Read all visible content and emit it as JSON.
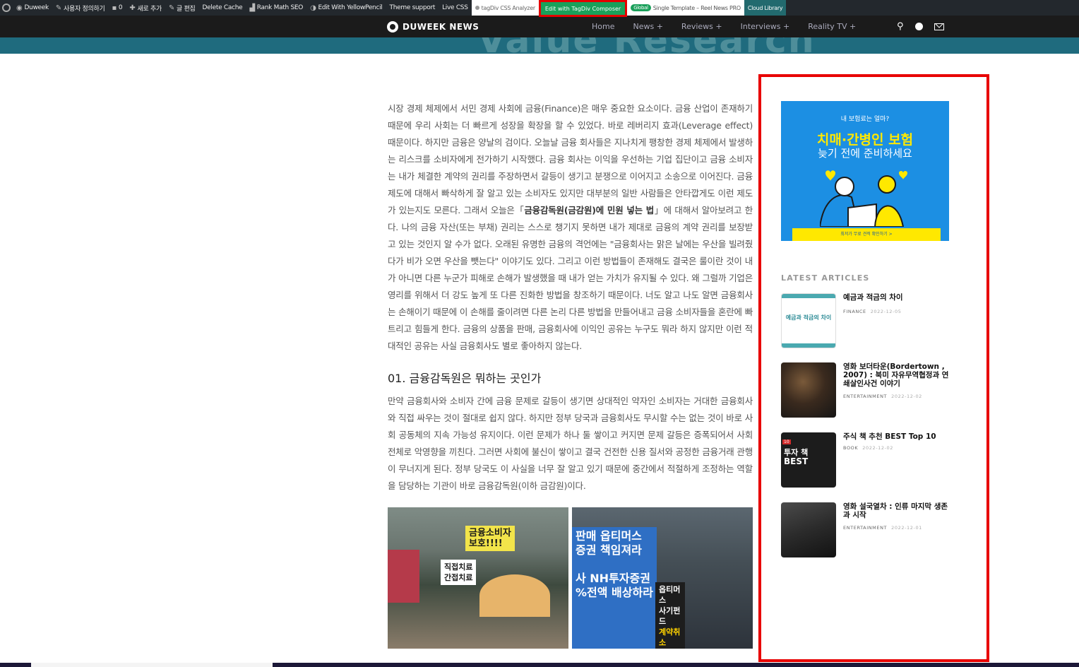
{
  "admin_bar": {
    "site_name": "Duweek",
    "customize": "사용자 정의하기",
    "comments": "0",
    "new": "새로 추가",
    "edit_post": "글 편집",
    "delete_cache": "Delete Cache",
    "rank_math": "Rank Math SEO",
    "yellowpencil": "Edit With YellowPencil",
    "theme_support": "Theme support",
    "live_css": "Live CSS",
    "css_analyzer": "tagDiv CSS Analyzer",
    "edit_composer": "Edit with TagDiv Composer",
    "global_badge": "Global",
    "single_template": "Single Template – Reel News PRO",
    "cloud_library": "Cloud Library"
  },
  "header": {
    "logo": "DUWEEK NEWS",
    "nav": [
      "Home",
      "News +",
      "Reviews +",
      "Interviews +",
      "Reality TV +"
    ]
  },
  "banner": {
    "text": "Value Research"
  },
  "article": {
    "intro_part1": "시장 경제 체제에서 서민 경제 사회에 금융(Finance)은 매우 중요한 요소이다. 금융 산업이 존재하기 때문에 우리 사회는 더 빠르게 성장을 확장을 할 수 있었다. 바로 레버리지 효과(Leverage effect) 때문이다. 하지만 금융은 양날의 검이다. 오늘날 금융 회사들은 지나치게 팽창한 경제 체제에서 발생하는 리스크를 소비자에게 전가하기 시작했다. 금융 회사는 이익을 우선하는 기업 집단이고 금융 소비자는 내가 체결한 계약의 권리를 주장하면서 갈등이 생기고 분쟁으로 이어지고 소송으로 이어진다. 금융 제도에 대해서 빠삭하게 잘 알고 있는 소비자도 있지만 대부분의 일반 사람들은 안타깝게도 이런 제도가 있는지도 모른다. 그래서 오늘은「",
    "intro_bold": "금융감독원(금감원)에 민원 넣는 법",
    "intro_part2": "」에 대해서 알아보려고 한다. 나의 금융 자산(또는 부채) 권리는 스스로 챙기지 못하면 내가 제대로 금융의 계약 권리를 보장받고 있는 것인지 알 수가 없다. 오래된 유명한 금융의 격언에는 \"금융회사는 맑은 날에는 우산을 빌려줬다가 비가 오면 우산을 뺏는다\" 이야기도 있다. 그리고 이런 방법들이 존재해도 결국은 룰이란 것이 내가 아니면 다른 누군가 피해로 손해가 발생했을 때 내가 얻는 가치가 유지될 수 있다. 왜 그럴까 기업은 영리를 위해서 더 강도 높게 또 다른 진화한 방법을 창조하기 때문이다. 너도 알고 나도 알면 금융회사는 손해이기 때문에 이 손해를 줄이려면 다른 논리 다른 방법을 만들어내고 금융 소비자들을 혼란에 빠트리고 힘들게 한다. 금융의 상품을 판매, 금융회사에 이익인 공유는 누구도 뭐라 하지 않지만 이런 적대적인 공유는 사실 금융회사도 별로 좋아하지 않는다.",
    "heading": "01. 금융감독원은 뭐하는 곳인가",
    "section_para": "만약 금융회사와 소비자 간에 금융 문제로 갈등이 생기면 상대적인 약자인 소비자는 거대한 금융회사와 직접 싸우는 것이 절대로 쉽지 않다. 하지만 정부 당국과 금융회사도 무시할 수는 없는 것이 바로 사회 공동체의 지속 가능성 유지이다. 이런 문제가 하나 둘 쌓이고 커지면 문제 갈등은 증폭되어서 사회 전체로 악영향을 끼친다. 그러면 사회에 불신이 쌓이고 결국 건전한 신용 질서와 공정한 금융거래 관행이 무너지게 된다. 정부 당국도 이 사실을 너무 잘 알고 있기 때문에 중간에서 적절하게 조정하는 역할을 담당하는 기관이 바로 금융감독원(이하 금감원)이다.",
    "photo1_signs": [
      "금융소비자",
      "보호!!!!",
      "직접치료",
      "간접치료"
    ],
    "photo2_signs": [
      "판매 옵티머스",
      "증권 책임져라",
      "사 NH투자증권",
      "%전액 배상하라",
      "옵티머스",
      "사기펀드",
      "계약취소"
    ]
  },
  "sidebar": {
    "ad": {
      "question": "내 보험료는 얼마?",
      "title1": "치매·간병인 보험",
      "title2": "늦기 전에 준비하세요",
      "cta": "최저가 무료 견적 확인하기 >"
    },
    "latest_label": "LATEST ARTICLES",
    "posts": [
      {
        "title": "예금과 적금의 차이",
        "category": "FINANCE",
        "date": "2022-12-05",
        "thumb_text": "예금과 적금의 차이"
      },
      {
        "title": "영화 보더타운(Bordertown , 2007) : 북미 자유무역협정과 연쇄살인사건 이야기",
        "category": "ENTERTAINMENT",
        "date": "2022-12-02"
      },
      {
        "title": "주식 책 추천 BEST Top 10",
        "category": "BOOK",
        "date": "2022-12-02",
        "thumb_tag": "10",
        "thumb_line1": "투자 책",
        "thumb_line2": "BEST"
      },
      {
        "title": "영화 설국열차 : 인류 마지막 생존과 시작",
        "category": "ENTERTAINMENT",
        "date": "2022-12-01"
      }
    ]
  }
}
